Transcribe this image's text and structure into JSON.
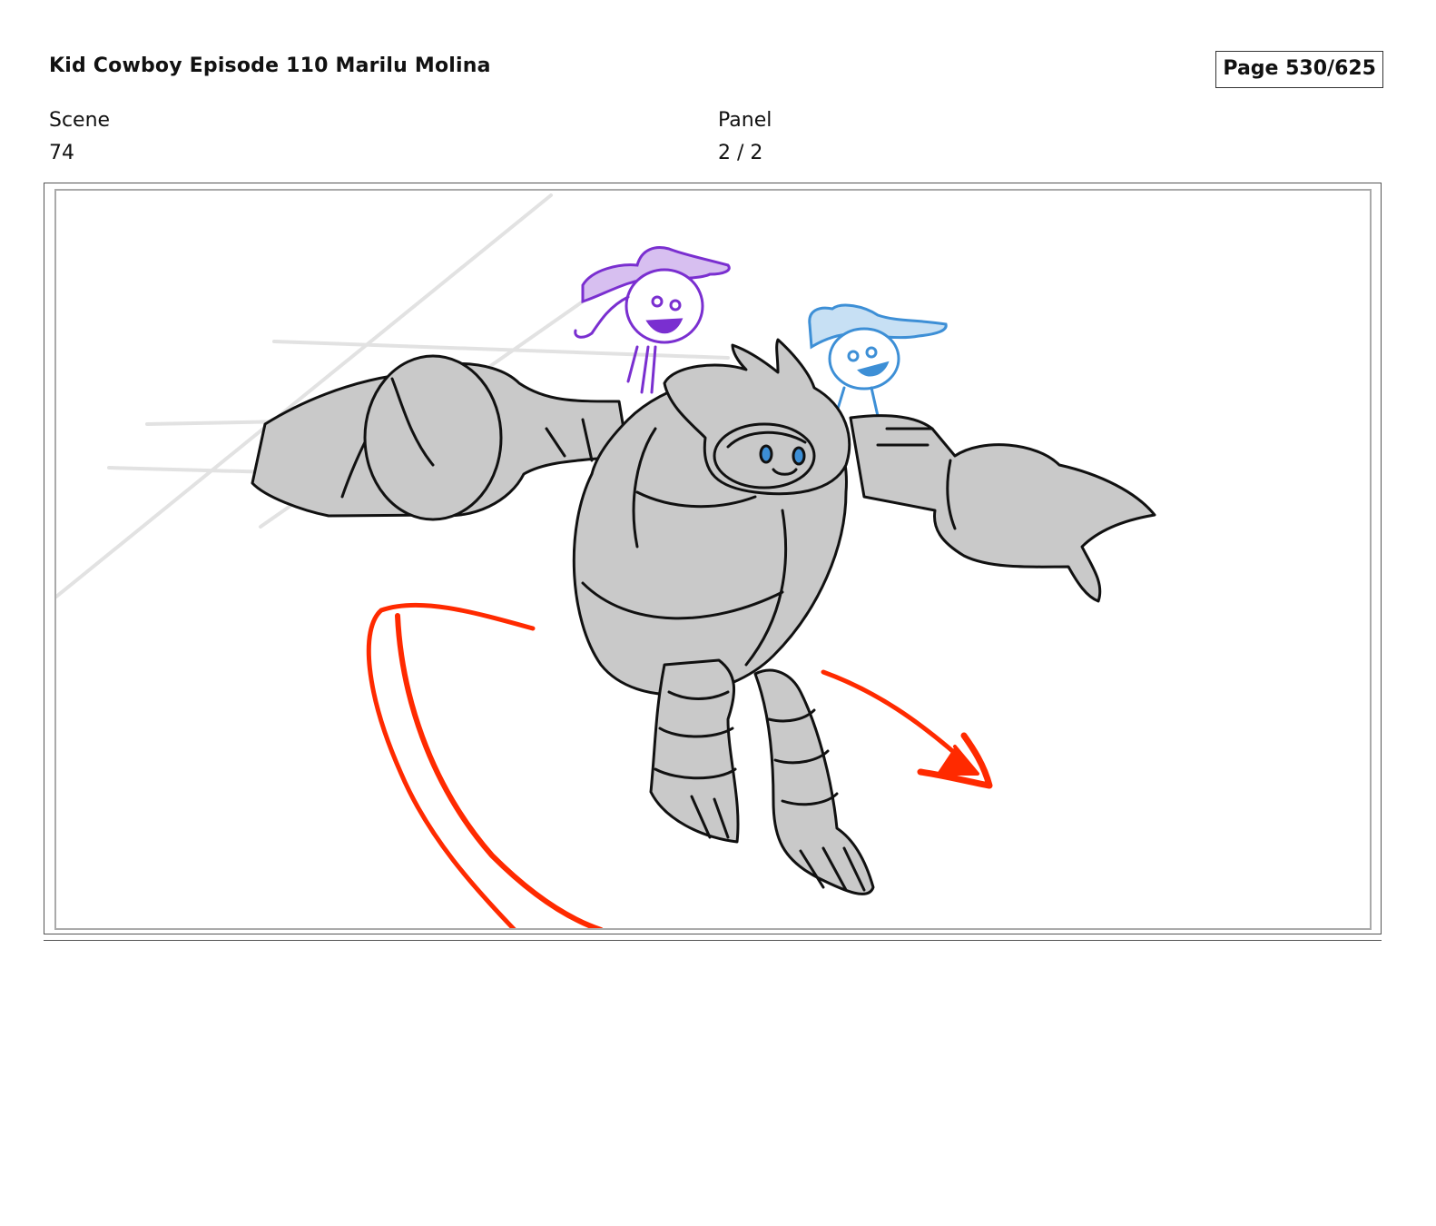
{
  "header": {
    "title": "Kid Cowboy Episode 110 Marilu Molina",
    "page": "Page 530/625"
  },
  "meta": {
    "scene_label": "Scene",
    "scene_value": "74",
    "panel_label": "Panel",
    "panel_value": "2 / 2"
  },
  "colors": {
    "sketch_ink": "#111111",
    "robot_fill": "#c9c9c9",
    "motion_arrow": "#ff2a00",
    "purple_character": "#7a2fd0",
    "blue_character": "#3d8fd6"
  }
}
